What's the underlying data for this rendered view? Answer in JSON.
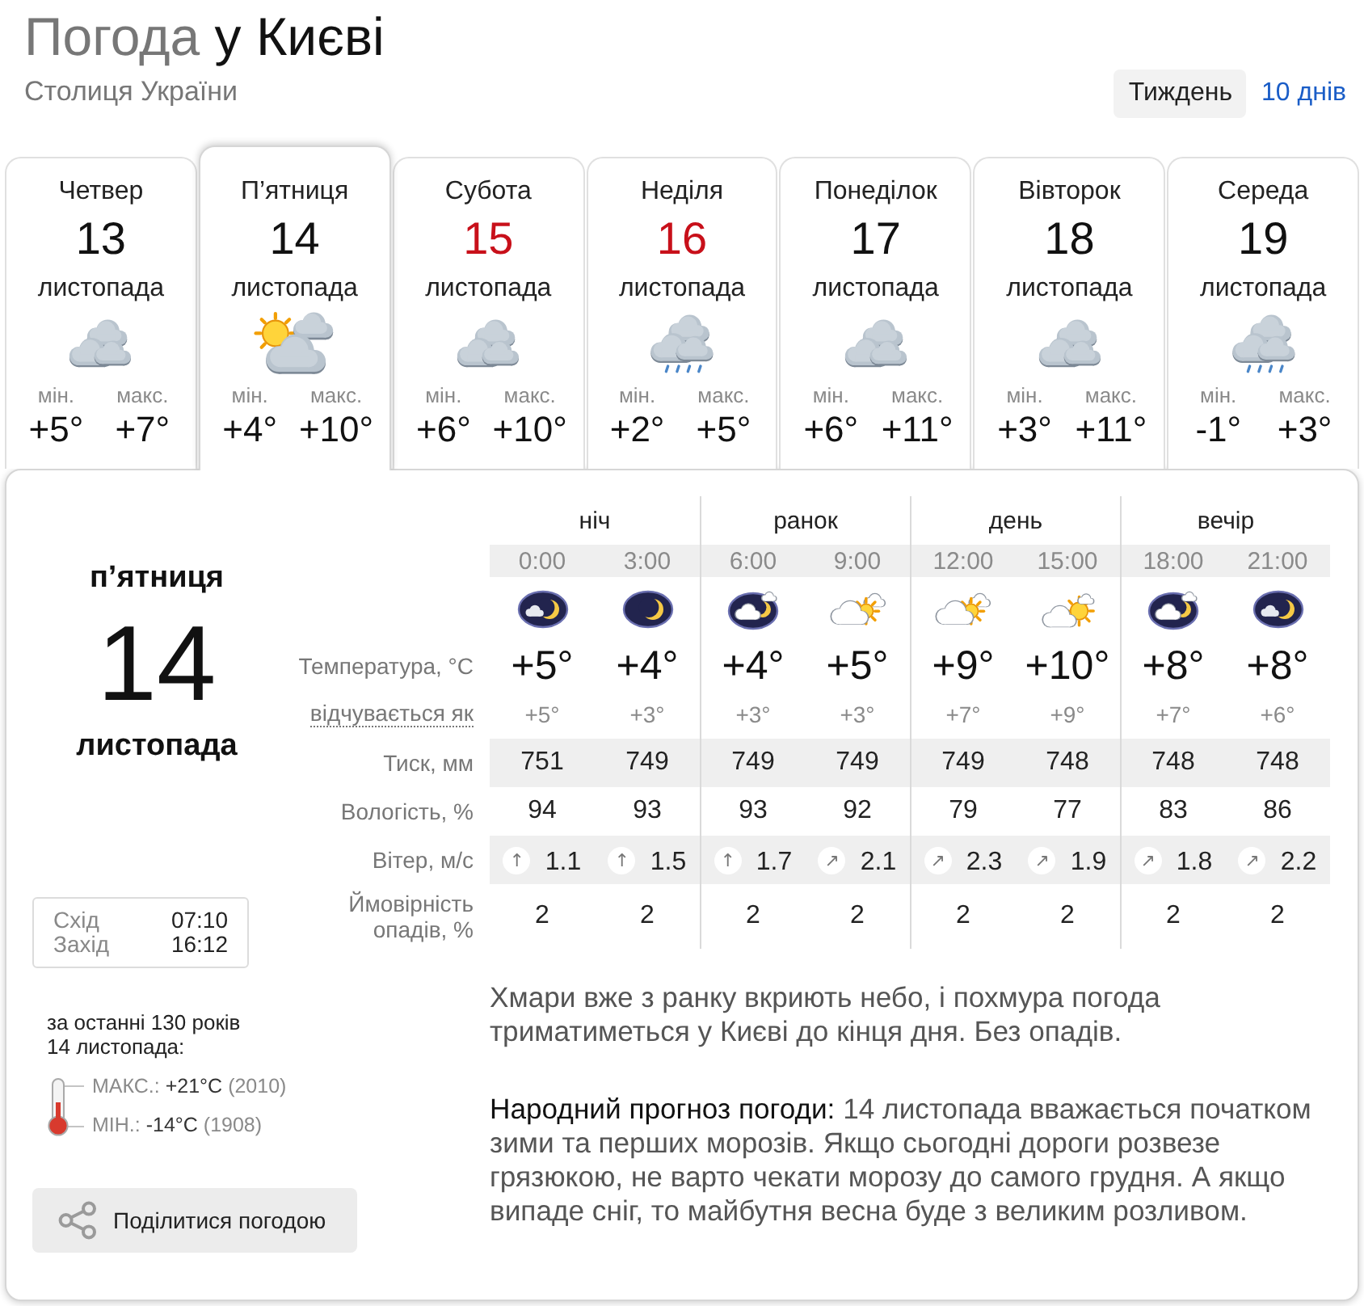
{
  "title": {
    "lead": "Погода",
    "place": "у Києві"
  },
  "subtitle": "Столиця України",
  "range_tabs": [
    {
      "label": "Тиждень",
      "selected": true
    },
    {
      "label": "10 днів",
      "selected": false
    }
  ],
  "days": [
    {
      "weekday": "Четвер",
      "date": "13",
      "month": "листопада",
      "kind": "overcast",
      "min_label": "мін.",
      "min": "+5°",
      "max_label": "макс.",
      "max": "+7°",
      "weekend": false,
      "selected": false
    },
    {
      "weekday": "П’ятниця",
      "date": "14",
      "month": "листопада",
      "kind": "sun-clouds",
      "min_label": "мін.",
      "min": "+4°",
      "max_label": "макс.",
      "max": "+10°",
      "weekend": false,
      "selected": true
    },
    {
      "weekday": "Субота",
      "date": "15",
      "month": "листопада",
      "kind": "overcast",
      "min_label": "мін.",
      "min": "+6°",
      "max_label": "макс.",
      "max": "+10°",
      "weekend": true,
      "selected": false
    },
    {
      "weekday": "Неділя",
      "date": "16",
      "month": "листопада",
      "kind": "rain",
      "min_label": "мін.",
      "min": "+2°",
      "max_label": "макс.",
      "max": "+5°",
      "weekend": true,
      "selected": false
    },
    {
      "weekday": "Понеділок",
      "date": "17",
      "month": "листопада",
      "kind": "overcast",
      "min_label": "мін.",
      "min": "+6°",
      "max_label": "макс.",
      "max": "+11°",
      "weekend": false,
      "selected": false
    },
    {
      "weekday": "Вівторок",
      "date": "18",
      "month": "листопада",
      "kind": "overcast",
      "min_label": "мін.",
      "min": "+3°",
      "max_label": "макс.",
      "max": "+11°",
      "weekend": false,
      "selected": false
    },
    {
      "weekday": "Середа",
      "date": "19",
      "month": "листопада",
      "kind": "rain",
      "min_label": "мін.",
      "min": "-1°",
      "max_label": "макс.",
      "max": "+3°",
      "weekend": false,
      "selected": false
    }
  ],
  "today": {
    "weekday": "п’ятниця",
    "date": "14",
    "month": "листопада"
  },
  "sun": {
    "sunrise_label": "Схід",
    "sunrise": "07:10",
    "sunset_label": "Захід",
    "sunset": "16:12"
  },
  "history": {
    "caption": [
      "за останні 130 років",
      "14 листопада:"
    ],
    "records": [
      {
        "label": "МАКС.:",
        "value": "+21°C",
        "year": "(2010)"
      },
      {
        "label": "МІН.:",
        "value": "-14°C",
        "year": "(1908)"
      }
    ]
  },
  "share_button": "Поділитися погодою",
  "hourly": {
    "periods": [
      "ніч",
      "ранок",
      "день",
      "вечір"
    ],
    "rows": [
      {
        "kind": "temperature",
        "label": "Температура, °C"
      },
      {
        "kind": "feels_like",
        "label": "відчувається як"
      },
      {
        "kind": "pressure",
        "label": "Тиск, мм"
      },
      {
        "kind": "humidity",
        "label": "Вологість, %"
      },
      {
        "kind": "wind",
        "label": "Вітер, м/с"
      },
      {
        "kind": "precipitation",
        "label": "Ймовірність опадів, %"
      }
    ],
    "hours": [
      {
        "time": "0:00",
        "kind": "night-moon-cloud",
        "temp": "+5°",
        "feels": "+5°",
        "pressure": "751",
        "humidity": "94",
        "arrow": "↑",
        "wind": "1.1",
        "precip": "2"
      },
      {
        "time": "3:00",
        "kind": "night-moon",
        "temp": "+4°",
        "feels": "+3°",
        "pressure": "749",
        "humidity": "93",
        "arrow": "↑",
        "wind": "1.5",
        "precip": "2"
      },
      {
        "time": "6:00",
        "kind": "night-cloud",
        "temp": "+4°",
        "feels": "+3°",
        "pressure": "749",
        "humidity": "93",
        "arrow": "↑",
        "wind": "1.7",
        "precip": "2"
      },
      {
        "time": "9:00",
        "kind": "sun-behind-clouds",
        "temp": "+5°",
        "feels": "+3°",
        "pressure": "749",
        "humidity": "92",
        "arrow": "↗",
        "wind": "2.1",
        "precip": "2"
      },
      {
        "time": "12:00",
        "kind": "sun-behind-clouds",
        "temp": "+9°",
        "feels": "+7°",
        "pressure": "749",
        "humidity": "79",
        "arrow": "↗",
        "wind": "2.3",
        "precip": "2"
      },
      {
        "time": "15:00",
        "kind": "sun-cloud",
        "temp": "+10°",
        "feels": "+9°",
        "pressure": "748",
        "humidity": "77",
        "arrow": "↗",
        "wind": "1.9",
        "precip": "2"
      },
      {
        "time": "18:00",
        "kind": "night-cloud",
        "temp": "+8°",
        "feels": "+7°",
        "pressure": "748",
        "humidity": "83",
        "arrow": "↗",
        "wind": "1.8",
        "precip": "2"
      },
      {
        "time": "21:00",
        "kind": "night-moon-cloud",
        "temp": "+8°",
        "feels": "+6°",
        "pressure": "748",
        "humidity": "86",
        "arrow": "↗",
        "wind": "2.2",
        "precip": "2"
      }
    ]
  },
  "description": "Хмари вже з ранку вкриють небо, і похмура погода триматиметься у Києві до кінця дня. Без опадів.",
  "folk": {
    "title": "Народний прогноз погоди:",
    "text": "14 листопада вважається початком зими та перших морозів. Якщо сьогодні дороги розвезе грязюкою, не варто чекати морозу до самого грудня. А якщо випаде сніг, то майбутня весна буде з великим розливом."
  }
}
